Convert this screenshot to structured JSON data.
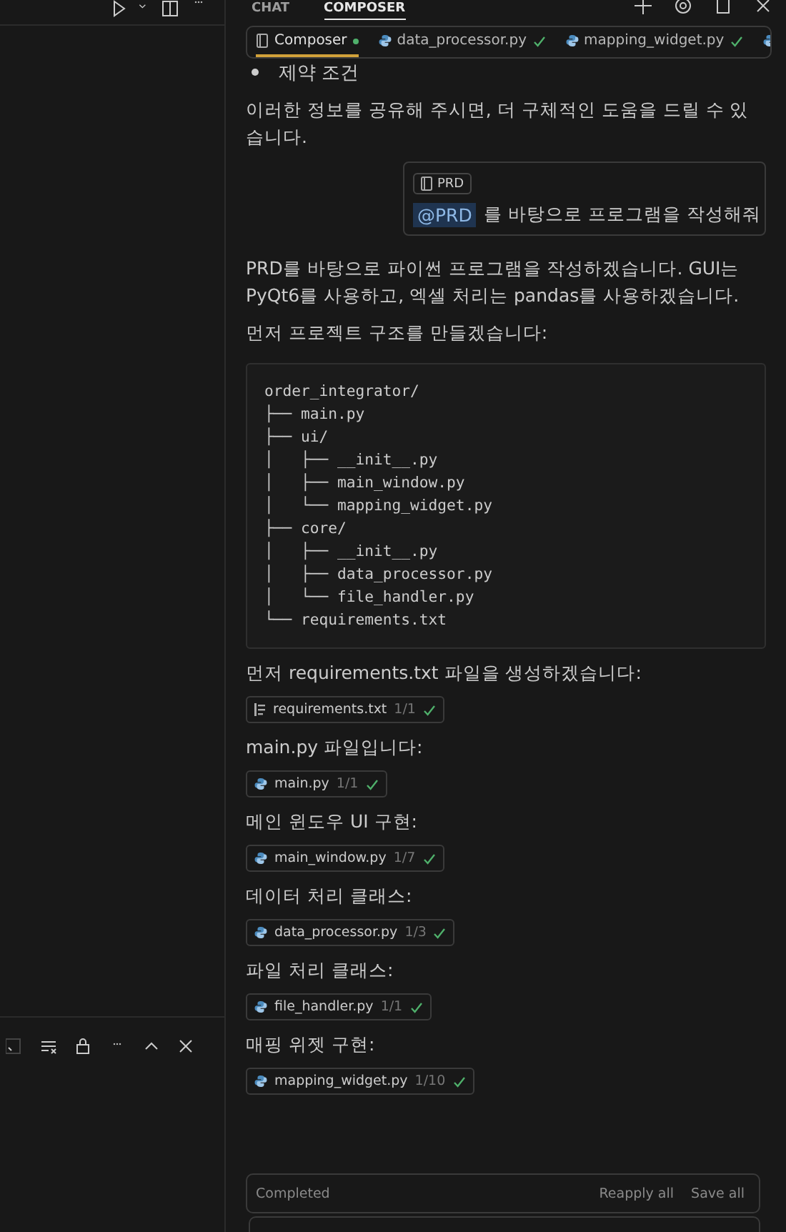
{
  "panel_tabs": [
    {
      "label": "CHAT",
      "selected": false
    },
    {
      "label": "COMPOSER",
      "selected": true
    }
  ],
  "file_tabs": [
    {
      "kind": "composer",
      "label": "Composer",
      "selected": true,
      "dot": true
    },
    {
      "kind": "python",
      "label": "data_processor.py",
      "selected": false,
      "done": true
    },
    {
      "kind": "python",
      "label": "mapping_widget.py",
      "selected": false,
      "done": true
    },
    {
      "kind": "python",
      "selected": false,
      "done": false
    }
  ],
  "messages": [
    {
      "kind": "bullet",
      "text": "제약 조건"
    },
    {
      "kind": "text",
      "text": "이러한 정보를 공유해 주시면, 더 구체적인 도움을 드릴 수 있습니다."
    },
    {
      "kind": "user",
      "attachment": "PRD",
      "mention": "@PRD",
      "text": "를 바탕으로 프로그램을 작성해줘"
    },
    {
      "kind": "text",
      "text": "PRD를 바탕으로 파이썬 프로그램을 작성하겠습니다. GUI는 PyQt6를 사용하고, 엑셀 처리는 pandas를 사용하겠습니다."
    },
    {
      "kind": "text",
      "text": "먼저 프로젝트 구조를 만들겠습니다:"
    },
    {
      "kind": "code",
      "lines": [
        "order_integrator/",
        "├── main.py",
        "├── ui/",
        "│   ├── __init__.py",
        "│   ├── main_window.py",
        "│   └── mapping_widget.py",
        "├── core/",
        "│   ├── __init__.py",
        "│   ├── data_processor.py",
        "│   └── file_handler.py",
        "└── requirements.txt"
      ]
    },
    {
      "kind": "text",
      "text": "먼저 requirements.txt 파일을 생성하겠습니다:"
    },
    {
      "kind": "textfile",
      "name": "requirements.txt",
      "count": "1/1",
      "done": true
    },
    {
      "kind": "text",
      "text": "main.py 파일입니다:"
    },
    {
      "kind": "pyfile",
      "name": "main.py",
      "count": "1/1",
      "done": true
    },
    {
      "kind": "text",
      "text": "메인 윈도우 UI 구현:"
    },
    {
      "kind": "pyfile",
      "name": "main_window.py",
      "count": "1/7",
      "done": true
    },
    {
      "kind": "text",
      "text": "데이터 처리 클래스:"
    },
    {
      "kind": "pyfile",
      "name": "data_processor.py",
      "count": "1/3",
      "done": true
    },
    {
      "kind": "text",
      "text": "파일 처리 클래스:"
    },
    {
      "kind": "pyfile",
      "name": "file_handler.py",
      "count": "1/1",
      "done": true
    },
    {
      "kind": "text",
      "text": "매핑 위젯 구현:"
    },
    {
      "kind": "pyfile",
      "name": "mapping_widget.py",
      "count": "1/10",
      "done": true
    }
  ],
  "status_bar": {
    "status": "Completed",
    "actions": [
      "Reapply all",
      "Save all"
    ]
  }
}
